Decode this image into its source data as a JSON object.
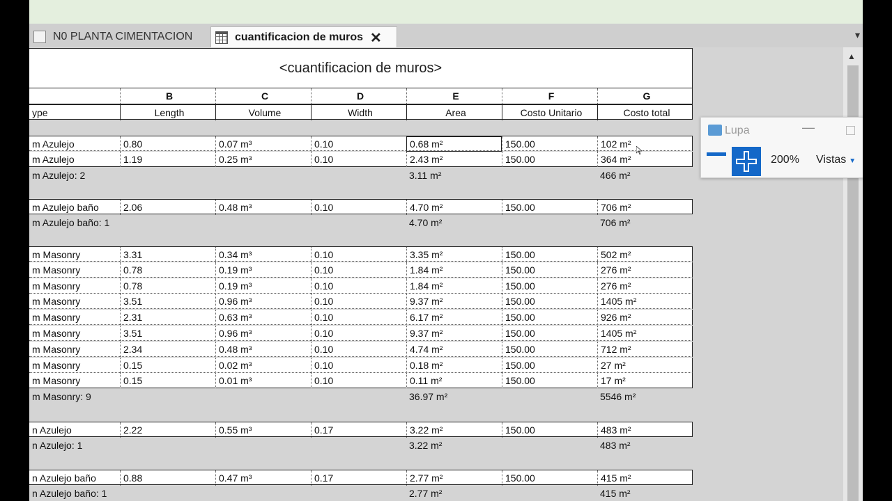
{
  "tabs": [
    {
      "label": "N0 PLANTA CIMENTACION",
      "icon": "floor-plan-icon",
      "active": false
    },
    {
      "label": "cuantificacion de muros",
      "icon": "schedule-table-icon",
      "active": true
    }
  ],
  "schedule": {
    "title": "<cuantificacion de muros>",
    "column_letters": [
      "",
      "B",
      "C",
      "D",
      "E",
      "F",
      "G"
    ],
    "column_names": [
      "ype",
      "Length",
      "Volume",
      "Width",
      "Area",
      "Costo Unitario",
      "Costo total"
    ],
    "groups": [
      {
        "rows": [
          [
            "m Azulejo",
            "0.80",
            "0.07 m³",
            "0.10",
            "0.68 m²",
            "150.00",
            "102 m²"
          ],
          [
            "m Azulejo",
            "1.19",
            "0.25 m³",
            "0.10",
            "2.43 m²",
            "150.00",
            "364 m²"
          ]
        ],
        "total": {
          "label": "m Azulejo: 2",
          "area": "3.11 m²",
          "cost": "466 m²"
        }
      },
      {
        "rows": [
          [
            "m Azulejo baño",
            "2.06",
            "0.48 m³",
            "0.10",
            "4.70 m²",
            "150.00",
            "706 m²"
          ]
        ],
        "total": {
          "label": "m Azulejo baño: 1",
          "area": "4.70 m²",
          "cost": "706 m²"
        }
      },
      {
        "rows": [
          [
            "m Masonry",
            "3.31",
            "0.34 m³",
            "0.10",
            "3.35 m²",
            "150.00",
            "502 m²"
          ],
          [
            "m Masonry",
            "0.78",
            "0.19 m³",
            "0.10",
            "1.84 m²",
            "150.00",
            "276 m²"
          ],
          [
            "m Masonry",
            "0.78",
            "0.19 m³",
            "0.10",
            "1.84 m²",
            "150.00",
            "276 m²"
          ],
          [
            "m Masonry",
            "3.51",
            "0.96 m³",
            "0.10",
            "9.37 m²",
            "150.00",
            "1405 m²"
          ],
          [
            "m Masonry",
            "2.31",
            "0.63 m³",
            "0.10",
            "6.17 m²",
            "150.00",
            "926 m²"
          ],
          [
            "m Masonry",
            "3.51",
            "0.96 m³",
            "0.10",
            "9.37 m²",
            "150.00",
            "1405 m²"
          ],
          [
            "m Masonry",
            "2.34",
            "0.48 m³",
            "0.10",
            "4.74 m²",
            "150.00",
            "712 m²"
          ],
          [
            "m Masonry",
            "0.15",
            "0.02 m³",
            "0.10",
            "0.18 m²",
            "150.00",
            "27 m²"
          ],
          [
            "m Masonry",
            "0.15",
            "0.01 m³",
            "0.10",
            "0.11 m²",
            "150.00",
            "17 m²"
          ]
        ],
        "total": {
          "label": "m Masonry: 9",
          "area": "36.97 m²",
          "cost": "5546 m²"
        }
      },
      {
        "rows": [
          [
            "n Azulejo",
            "2.22",
            "0.55 m³",
            "0.17",
            "3.22 m²",
            "150.00",
            "483 m²"
          ]
        ],
        "total": {
          "label": "n Azulejo: 1",
          "area": "3.22 m²",
          "cost": "483 m²"
        }
      },
      {
        "rows": [
          [
            "n Azulejo baño",
            "0.88",
            "0.47 m³",
            "0.17",
            "2.77 m²",
            "150.00",
            "415 m²"
          ]
        ],
        "total": {
          "label": "n Azulejo baño: 1",
          "area": "2.77 m²",
          "cost": "415 m²"
        }
      }
    ]
  },
  "magnifier": {
    "title": "Lupa",
    "zoom_level": "200%",
    "views_label": "Vistas",
    "min_symbol": "—"
  },
  "colors": {
    "accent": "#1468c8",
    "header_strip": "#e4efde",
    "background": "#d4d4d4"
  }
}
